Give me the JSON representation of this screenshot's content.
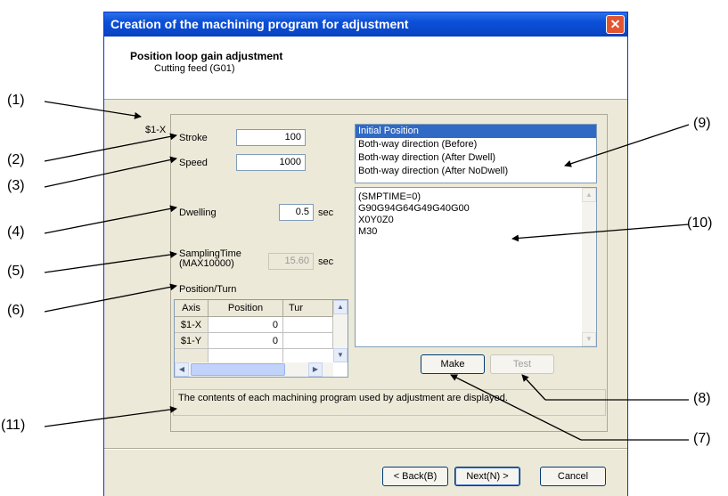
{
  "window": {
    "title": "Creation of the machining program for adjustment",
    "close_glyph": "✕"
  },
  "header": {
    "title": "Position loop gain adjustment",
    "subtitle": "Cutting feed (G01)"
  },
  "axis_label": "$1-X",
  "stroke": {
    "label": "Stroke",
    "value": "100"
  },
  "speed": {
    "label": "Speed",
    "value": "1000"
  },
  "dwelling": {
    "label": "Dwelling",
    "value": "0.5",
    "unit": "sec"
  },
  "sampling": {
    "label_line1": "SamplingTime",
    "label_line2": "(MAX10000)",
    "value": "15.60",
    "unit": "sec"
  },
  "position_turn": {
    "label": "Position/Turn",
    "columns": [
      "Axis",
      "Position",
      "Tur"
    ],
    "rows": [
      {
        "axis": "$1-X",
        "position": "0"
      },
      {
        "axis": "$1-Y",
        "position": "0"
      }
    ]
  },
  "position_list": {
    "items": [
      "Initial Position",
      "Both-way direction (Before)",
      "Both-way direction (After Dwell)",
      "Both-way direction (After NoDwell)"
    ],
    "selected_index": 0
  },
  "program_lines": [
    "(SMPTIME=0)",
    "G90G94G64G49G40G00",
    "X0Y0Z0",
    "M30"
  ],
  "buttons": {
    "make": "Make",
    "test": "Test",
    "back": "< Back(B)",
    "next": "Next(N) >",
    "cancel": "Cancel"
  },
  "message": "The contents of each machining program used by adjustment are displayed.",
  "callouts": [
    "(1)",
    "(2)",
    "(3)",
    "(4)",
    "(5)",
    "(6)",
    "(7)",
    "(8)",
    "(9)",
    "(10)",
    "(11)"
  ],
  "colors": {
    "title_bar": "#0b4fd9",
    "dialog_bg": "#ece9d8",
    "selection": "#316ac5",
    "close_button": "#e2562f"
  },
  "icons": {
    "close": "close-icon",
    "scroll_up": "chevron-up-icon",
    "scroll_down": "chevron-down-icon",
    "scroll_left": "chevron-left-icon",
    "scroll_right": "chevron-right-icon"
  }
}
